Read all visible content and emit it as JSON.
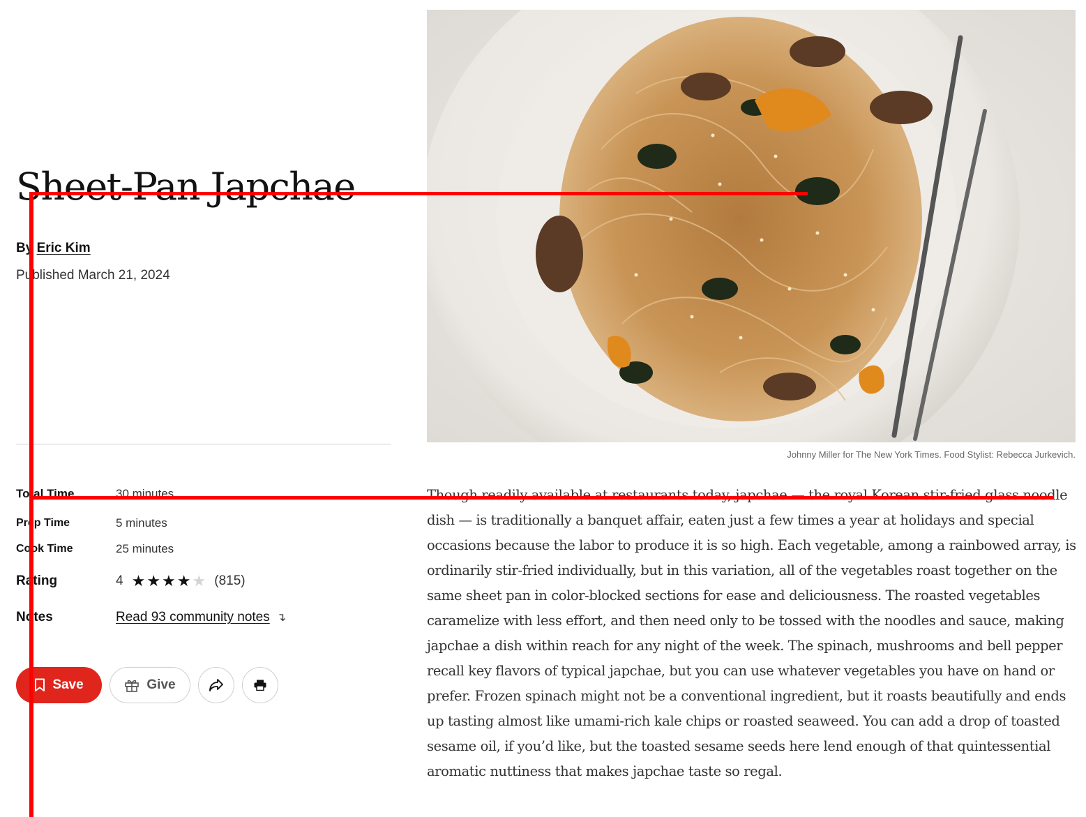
{
  "recipe": {
    "title": "Sheet-Pan Japchae",
    "byline_prefix": "By",
    "author": "Eric Kim",
    "published": "Published March 21, 2024"
  },
  "meta": {
    "total_time_label": "Total Time",
    "total_time_value": "30 minutes",
    "prep_time_label": "Prep Time",
    "prep_time_value": "5 minutes",
    "cook_time_label": "Cook Time",
    "cook_time_value": "25 minutes",
    "rating_label": "Rating",
    "rating_value": "4",
    "rating_stars_filled": 4,
    "rating_stars_total": 5,
    "rating_count": "(815)",
    "notes_label": "Notes",
    "notes_link": "Read 93 community notes"
  },
  "actions": {
    "save_label": "Save",
    "give_label": "Give"
  },
  "photo": {
    "credit": "Johnny Miller for The New York Times. Food Stylist: Rebecca Jurkevich."
  },
  "intro": "Though readily available at restaurants today, japchae — the royal Korean stir-fried glass noodle dish — is traditionally a banquet affair, eaten just a few times a year at holidays and special occasions because the labor to produce it is so high. Each vegetable, among a rainbowed array, is ordinarily stir-fried individually, but in this variation, all of the vegetables roast together on the same sheet pan in color-blocked sections for ease and deliciousness. The roasted vegetables caramelize with less effort, and then need only to be tossed with the noodles and sauce, making japchae a dish within reach for any night of the week. The spinach, mushrooms and bell pepper recall key flavors of typical japchae, but you can use whatever vegetables you have on hand or prefer. Frozen spinach might not be a conventional ingredient, but it roasts beautifully and ends up tasting almost like umami-rich kale chips or roasted seaweed. You can add a drop of toasted sesame oil, if you’d like, but the toasted sesame seeds here lend enough of that quintessential aromatic nuttiness that makes japchae taste so regal.",
  "colors": {
    "save_red": "#e0251c",
    "overlay_red": "#ff0000"
  }
}
